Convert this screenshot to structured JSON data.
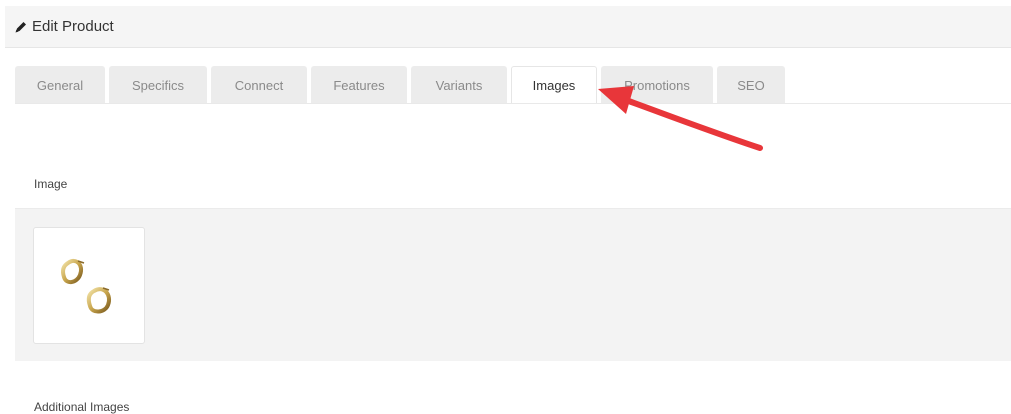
{
  "header": {
    "icon": "pencil-icon",
    "title": "Edit Product"
  },
  "tabs": [
    {
      "label": "General",
      "active": false
    },
    {
      "label": "Specifics",
      "active": false
    },
    {
      "label": "Connect",
      "active": false
    },
    {
      "label": "Features",
      "active": false
    },
    {
      "label": "Variants",
      "active": false
    },
    {
      "label": "Images",
      "active": true
    },
    {
      "label": "Promotions",
      "active": false
    },
    {
      "label": "SEO",
      "active": false
    }
  ],
  "image_section": {
    "label": "Image",
    "thumbnail_icon": "earrings-image"
  },
  "additional_images": {
    "label": "Additional Images"
  },
  "annotation": {
    "arrow_color": "#e8363a",
    "icon": "red-arrow-annotation"
  }
}
